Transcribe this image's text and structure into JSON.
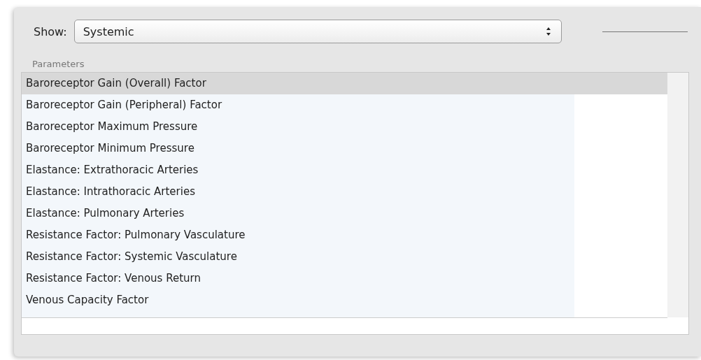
{
  "show": {
    "label": "Show:",
    "value": "Systemic"
  },
  "parameters": {
    "label": "Parameters",
    "items": [
      {
        "label": "Baroreceptor Gain (Overall) Factor",
        "selected": true
      },
      {
        "label": "Baroreceptor Gain (Peripheral) Factor",
        "selected": false
      },
      {
        "label": "Baroreceptor Maximum Pressure",
        "selected": false
      },
      {
        "label": "Baroreceptor Minimum Pressure",
        "selected": false
      },
      {
        "label": "Elastance: Extrathoracic Arteries",
        "selected": false
      },
      {
        "label": "Elastance: Intrathoracic Arteries",
        "selected": false
      },
      {
        "label": "Elastance: Pulmonary Arteries",
        "selected": false
      },
      {
        "label": "Resistance Factor: Pulmonary Vasculature",
        "selected": false
      },
      {
        "label": "Resistance Factor: Systemic Vasculature",
        "selected": false
      },
      {
        "label": "Resistance Factor: Venous Return",
        "selected": false
      },
      {
        "label": "Venous Capacity Factor",
        "selected": false
      }
    ]
  }
}
